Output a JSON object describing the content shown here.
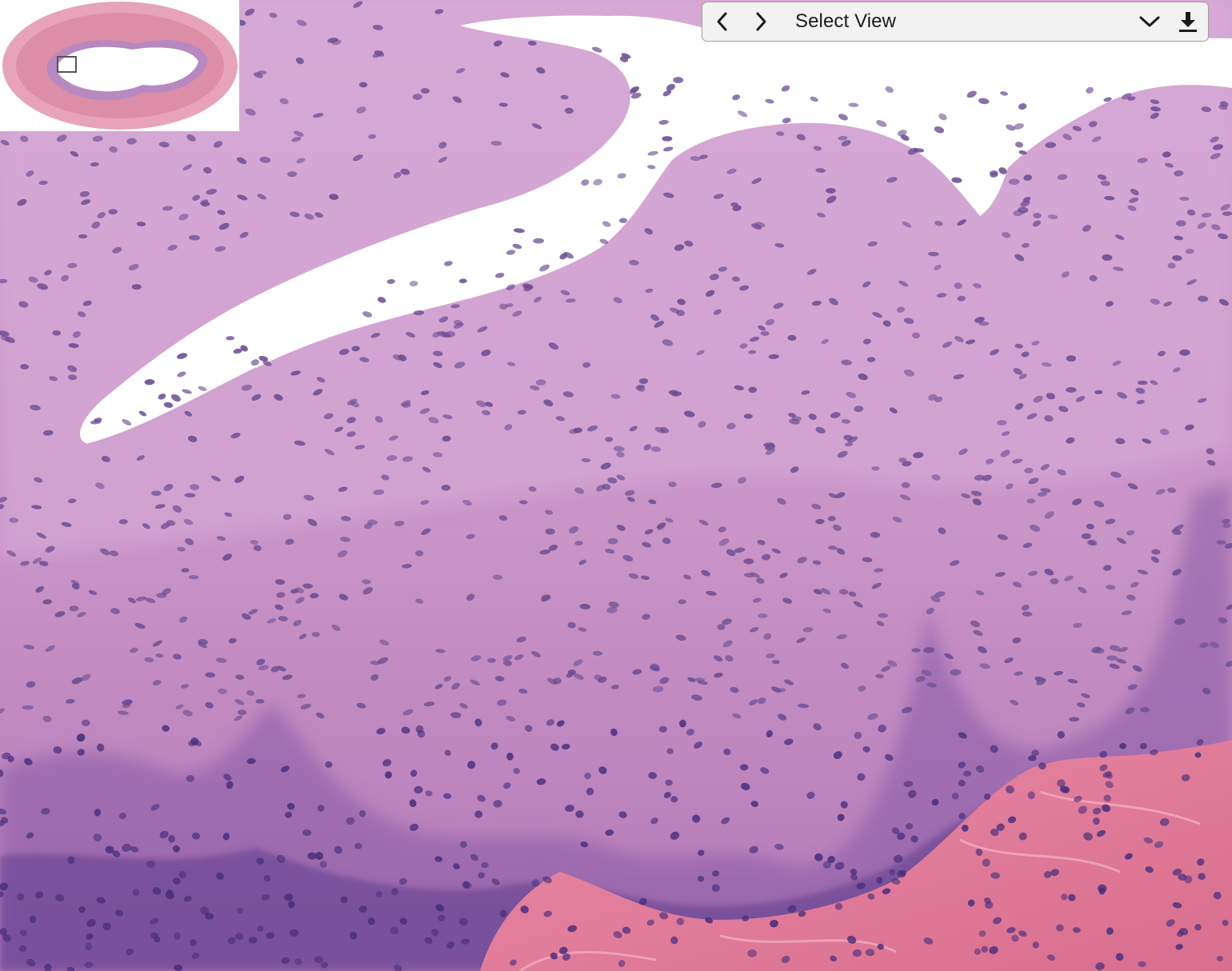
{
  "toolbar": {
    "view_select_label": "Select View",
    "prev_icon": "chevron-left-icon",
    "next_icon": "chevron-right-icon",
    "dropdown_icon": "chevron-down-icon",
    "download_icon": "download-icon"
  },
  "colors": {
    "tissue": "#c98fc4",
    "tissue_light": "#d6a6d2",
    "basal_nuclei": "#4a2f7d",
    "stroma": "#e07a96",
    "lumen": "#ffffff",
    "toolbar_bg": "#f2f2f2"
  }
}
